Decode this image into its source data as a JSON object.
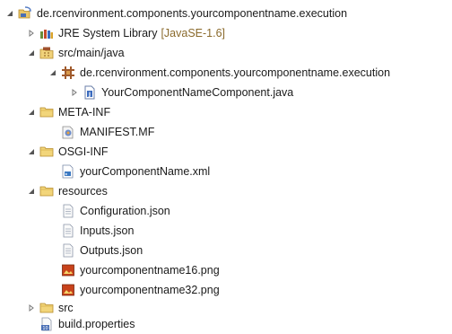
{
  "tree": {
    "project": {
      "label": "de.rcenvironment.components.yourcomponentname.execution",
      "icon": "java-project-icon"
    },
    "jre": {
      "label": "JRE System Library",
      "decoration": "[JavaSE-1.6]",
      "icon": "library-icon"
    },
    "src_main_java": {
      "label": "src/main/java",
      "icon": "source-folder-icon"
    },
    "package": {
      "label": "de.rcenvironment.components.yourcomponentname.execution",
      "icon": "package-icon"
    },
    "java_file": {
      "label": "YourComponentNameComponent.java",
      "icon": "java-file-icon"
    },
    "meta_inf": {
      "label": "META-INF",
      "icon": "folder-icon"
    },
    "manifest": {
      "label": "MANIFEST.MF",
      "icon": "manifest-icon"
    },
    "osgi_inf": {
      "label": "OSGI-INF",
      "icon": "folder-icon"
    },
    "xml_file": {
      "label": "yourComponentName.xml",
      "icon": "xml-file-icon"
    },
    "resources": {
      "label": "resources",
      "icon": "folder-icon"
    },
    "config_json": {
      "label": "Configuration.json",
      "icon": "text-file-icon"
    },
    "inputs_json": {
      "label": "Inputs.json",
      "icon": "text-file-icon"
    },
    "outputs_json": {
      "label": "Outputs.json",
      "icon": "text-file-icon"
    },
    "png16": {
      "label": "yourcomponentname16.png",
      "icon": "image-file-icon"
    },
    "png32": {
      "label": "yourcomponentname32.png",
      "icon": "image-file-icon"
    },
    "src": {
      "label": "src",
      "icon": "folder-icon"
    },
    "build_properties": {
      "label": "build.properties",
      "icon": "properties-file-icon"
    }
  }
}
